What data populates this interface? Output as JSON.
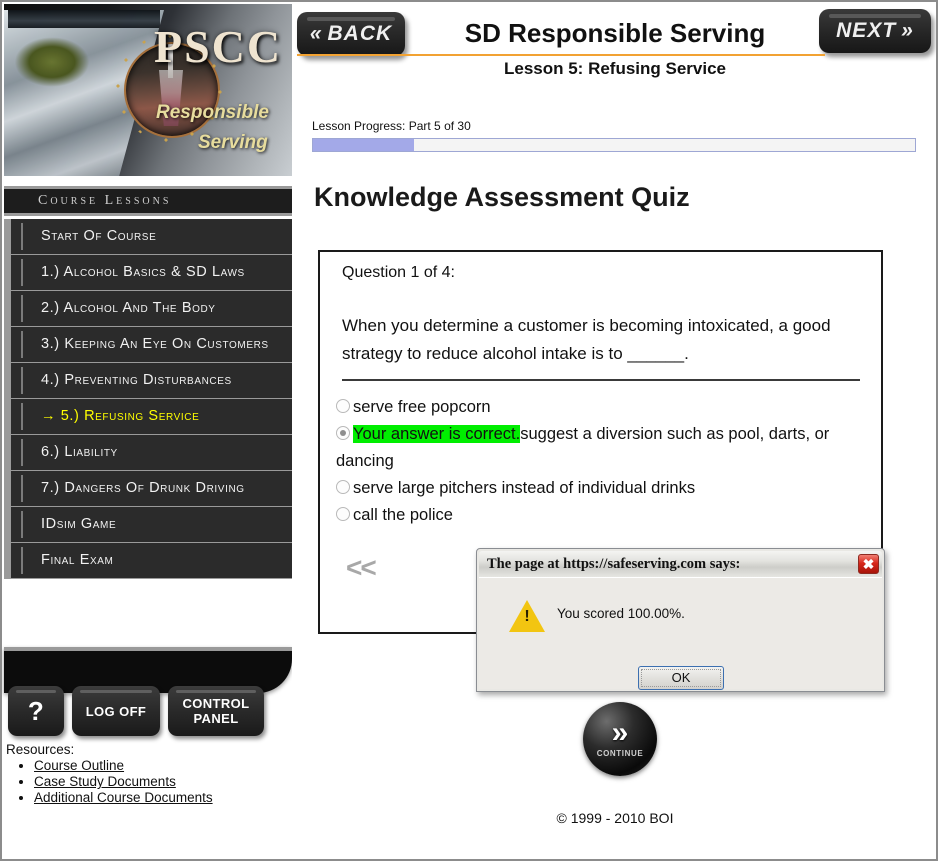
{
  "branding": {
    "logo_text": "PSCC",
    "tagline_line1": "Responsible",
    "tagline_line2": "Serving"
  },
  "sidebar": {
    "menu_header": "Course Lessons",
    "lessons": [
      {
        "label": "Start Of Course",
        "active": false
      },
      {
        "label": "1.) Alcohol Basics & SD Laws",
        "active": false
      },
      {
        "label": "2.) Alcohol And The Body",
        "active": false
      },
      {
        "label": "3.) Keeping An Eye On Customers",
        "active": false
      },
      {
        "label": "4.) Preventing Disturbances",
        "active": false
      },
      {
        "label": "→ 5.) Refusing Service",
        "active": true
      },
      {
        "label": "6.) Liability",
        "active": false
      },
      {
        "label": "7.) Dangers Of Drunk Driving",
        "active": false
      },
      {
        "label": "IDsim Game",
        "active": false
      },
      {
        "label": "Final Exam",
        "active": false
      }
    ],
    "buttons": {
      "help": "?",
      "log_off": "LOG OFF",
      "control_panel_line1": "CONTROL",
      "control_panel_line2": "PANEL"
    },
    "resources_label": "Resources:",
    "resources": [
      "Course Outline",
      "Case Study Documents",
      "Additional Course Documents"
    ]
  },
  "header": {
    "back_label": "BACK",
    "back_icon": "double-chevron-left-icon",
    "next_label": "NEXT",
    "next_icon": "double-chevron-right-icon",
    "course_title": "SD Responsible Serving",
    "lesson_subtitle": "Lesson 5: Refusing Service",
    "rule_color": "#f2a232"
  },
  "progress": {
    "label": "Lesson Progress: Part 5 of 30",
    "current_part": 5,
    "total_parts": 30,
    "percent": 16.7,
    "fill_color": "#a3a9e8",
    "track_color": "#f4f4f4"
  },
  "quiz": {
    "heading": "Knowledge Assessment Quiz",
    "question_counter": "Question 1 of 4:",
    "question_number": 1,
    "question_total": 4,
    "question_text": "When you determine a customer is becoming intoxicated, a good strategy to reduce alcohol intake is to ______.",
    "feedback_badge": "Your answer is correct.",
    "feedback_color": "#00ee00",
    "answers": [
      {
        "text": "serve free popcorn",
        "selected": false,
        "correct": false
      },
      {
        "text": "suggest a diversion such as pool, darts, or dancing",
        "selected": true,
        "correct": true
      },
      {
        "text": "serve large pitchers instead of individual drinks",
        "selected": false,
        "correct": false
      },
      {
        "text": "call the police",
        "selected": false,
        "correct": false
      }
    ],
    "prev_arrows": "<<"
  },
  "footer": {
    "continue_label": "CONTINUE",
    "continue_icon": "double-chevron-right-icon",
    "copyright": "© 1999 - 2010 BOI"
  },
  "alert": {
    "title": "The page at https://safeserving.com says:",
    "message": "You scored 100.00%.",
    "ok_label": "OK",
    "close_icon": "close-icon",
    "warning_icon": "warning-triangle-icon"
  }
}
